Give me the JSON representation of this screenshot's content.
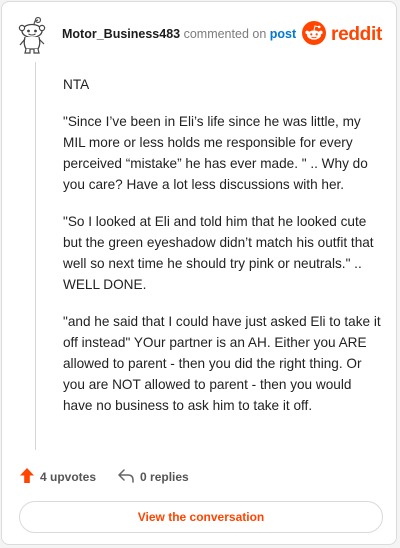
{
  "header": {
    "username": "Motor_Business483",
    "commented_text": " commented on ",
    "post_link": "post",
    "brand": "reddit",
    "brand_color": "#ff4500",
    "avatar_icon": "snoo-avatar-icon",
    "logo_icon": "reddit-logo-icon"
  },
  "comment": {
    "paragraphs": [
      "NTA",
      "\"Since I’ve been in Eli’s life since he was little, my MIL more or less holds me responsible for every perceived “mistake” he has ever made. \" .. Why do you care? Have a lot less discussions with her.",
      "\"So I looked at Eli and told him that he looked cute but the green eyeshadow didn’t match his outfit that well so next time he should try pink or neutrals.\" .. WELL DONE.",
      "\"and he said that I could have just asked Eli to take it off instead\" YOur partner is an AH. Either you ARE allowed to parent - then you did the right thing. Or you are NOT allowed to parent - then you would have no business to ask him to take it off."
    ]
  },
  "footer": {
    "upvotes": "4 upvotes",
    "replies": "0 replies",
    "upvote_icon": "upvote-arrow-icon",
    "reply_icon": "reply-arrow-icon",
    "upvote_color": "#ff4500"
  },
  "cta": {
    "label": "View the conversation"
  }
}
